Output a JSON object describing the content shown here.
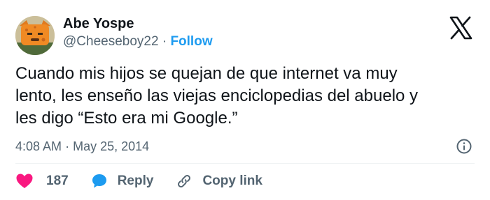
{
  "author": {
    "name": "Abe Yospe",
    "handle": "@Cheeseboy22",
    "separator": "·",
    "follow_label": "Follow"
  },
  "tweet": {
    "text": "Cuando mis hijos se quejan de que internet va muy\nlento, les enseño las viejas enciclopedias del abuelo y\nles digo “Esto era mi Google.”",
    "time": "4:08 AM",
    "meta_separator": "·",
    "date": "May 25, 2014"
  },
  "actions": {
    "like_count": "187",
    "reply_label": "Reply",
    "copy_link_label": "Copy link"
  },
  "colors": {
    "text": "#0f1419",
    "secondary": "#536471",
    "accent": "#1d9bf0",
    "like": "#f91880"
  },
  "icons": {
    "brand": "x-logo-icon",
    "info": "info-icon",
    "like": "heart-icon",
    "reply": "speech-bubble-icon",
    "copy_link": "link-icon"
  }
}
